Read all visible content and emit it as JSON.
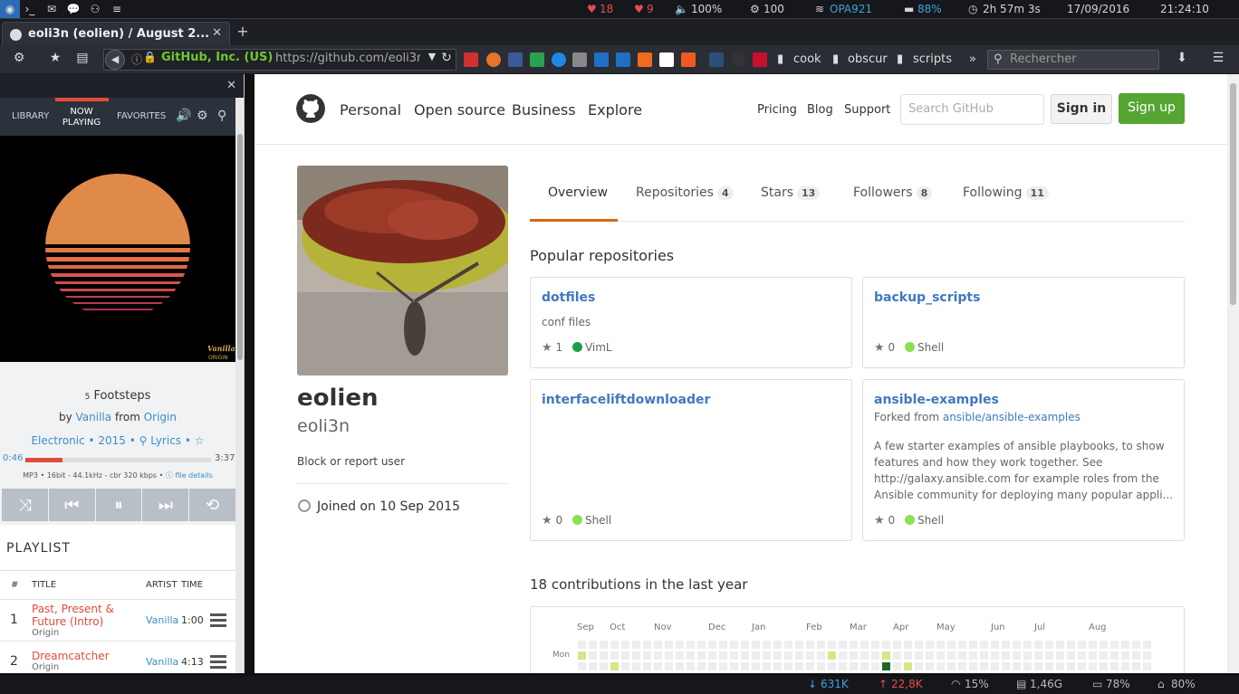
{
  "topbar": {
    "notif_hearts": "18",
    "notif_2": "9",
    "volume": "100%",
    "cpu": "100",
    "wifi": "OPA921",
    "battery": "88%",
    "battery_time": "2h 57m 3s",
    "date": "17/09/2016",
    "time": "21:24:10"
  },
  "browser": {
    "tab_title": "eoli3n (eolien) / August 2...",
    "new_tab": "+",
    "identity": "GitHub, Inc. (US)",
    "url": "https://github.com/eoli3n",
    "bookmark_folders": [
      "cook",
      "obscur",
      "scripts"
    ],
    "search_placeholder": "Rechercher",
    "overflow": "»"
  },
  "sidebar": {
    "nav": [
      "LIBRARY",
      "NOW PLAYING",
      "FAVORITES"
    ],
    "track_no": "5",
    "track_title": "Footsteps",
    "by_label": "by",
    "artist": "Vanilla",
    "from_label": "from",
    "album": "Origin",
    "genre": "Electronic",
    "year": "2015",
    "lyrics": "Lyrics",
    "elapsed": "0:46",
    "duration": "3:37",
    "progress": 0.2,
    "format": "MP3 • 16bit - 44.1kHz - cbr 320 kbps •",
    "file_details": "file details",
    "art_text_1": "Vanilla",
    "art_text_2": "ORIGIN",
    "playlist_title": "PLAYLIST",
    "columns": [
      "#",
      "TITLE",
      "ARTIST",
      "TIME"
    ],
    "rows": [
      {
        "num": "1",
        "title": "Past, Present & Future (Intro)",
        "album": "Origin",
        "artist": "Vanilla",
        "time": "1:00"
      },
      {
        "num": "2",
        "title": "Dreamcatcher",
        "album": "Origin",
        "artist": "Vanilla",
        "time": "4:13"
      }
    ]
  },
  "github": {
    "nav": [
      "Personal",
      "Open source",
      "Business",
      "Explore"
    ],
    "nav_right": [
      "Pricing",
      "Blog",
      "Support"
    ],
    "search_placeholder": "Search GitHub",
    "signin": "Sign in",
    "signup": "Sign up",
    "name": "eolien",
    "login": "eoli3n",
    "block": "Block or report user",
    "joined": "Joined on 10 Sep 2015",
    "tabs": [
      {
        "label": "Overview",
        "count": ""
      },
      {
        "label": "Repositories",
        "count": "4"
      },
      {
        "label": "Stars",
        "count": "13"
      },
      {
        "label": "Followers",
        "count": "8"
      },
      {
        "label": "Following",
        "count": "11"
      }
    ],
    "popular_title": "Popular repositories",
    "repos": [
      {
        "name": "dotfiles",
        "desc": "conf files",
        "stars": "1",
        "lang": "VimL",
        "lang_color": "#199f4b"
      },
      {
        "name": "backup_scripts",
        "desc": "",
        "stars": "0",
        "lang": "Shell",
        "lang_color": "#89e051"
      },
      {
        "name": "interfaceliftdownloader",
        "desc": "",
        "stars": "0",
        "lang": "Shell",
        "lang_color": "#89e051"
      },
      {
        "name": "ansible-examples",
        "fork_prefix": "Forked from",
        "fork_src": "ansible/ansible-examples",
        "desc": "A few starter examples of ansible playbooks, to show features and how they work together. See http://galaxy.ansible.com for example roles from the Ansible community for deploying many popular appli...",
        "stars": "0",
        "lang": "Shell",
        "lang_color": "#89e051"
      }
    ],
    "contrib_title": "18 contributions in the last year",
    "months": [
      "Sep",
      "Oct",
      "Nov",
      "Dec",
      "Jan",
      "Feb",
      "Mar",
      "Apr",
      "May",
      "Jun",
      "Jul",
      "Aug"
    ],
    "day_label": "Mon"
  },
  "bottombar": {
    "down": "631K",
    "up": "22,8K",
    "cpu": "15%",
    "mem": "1,46G",
    "disk": "78%",
    "home": "80%"
  }
}
